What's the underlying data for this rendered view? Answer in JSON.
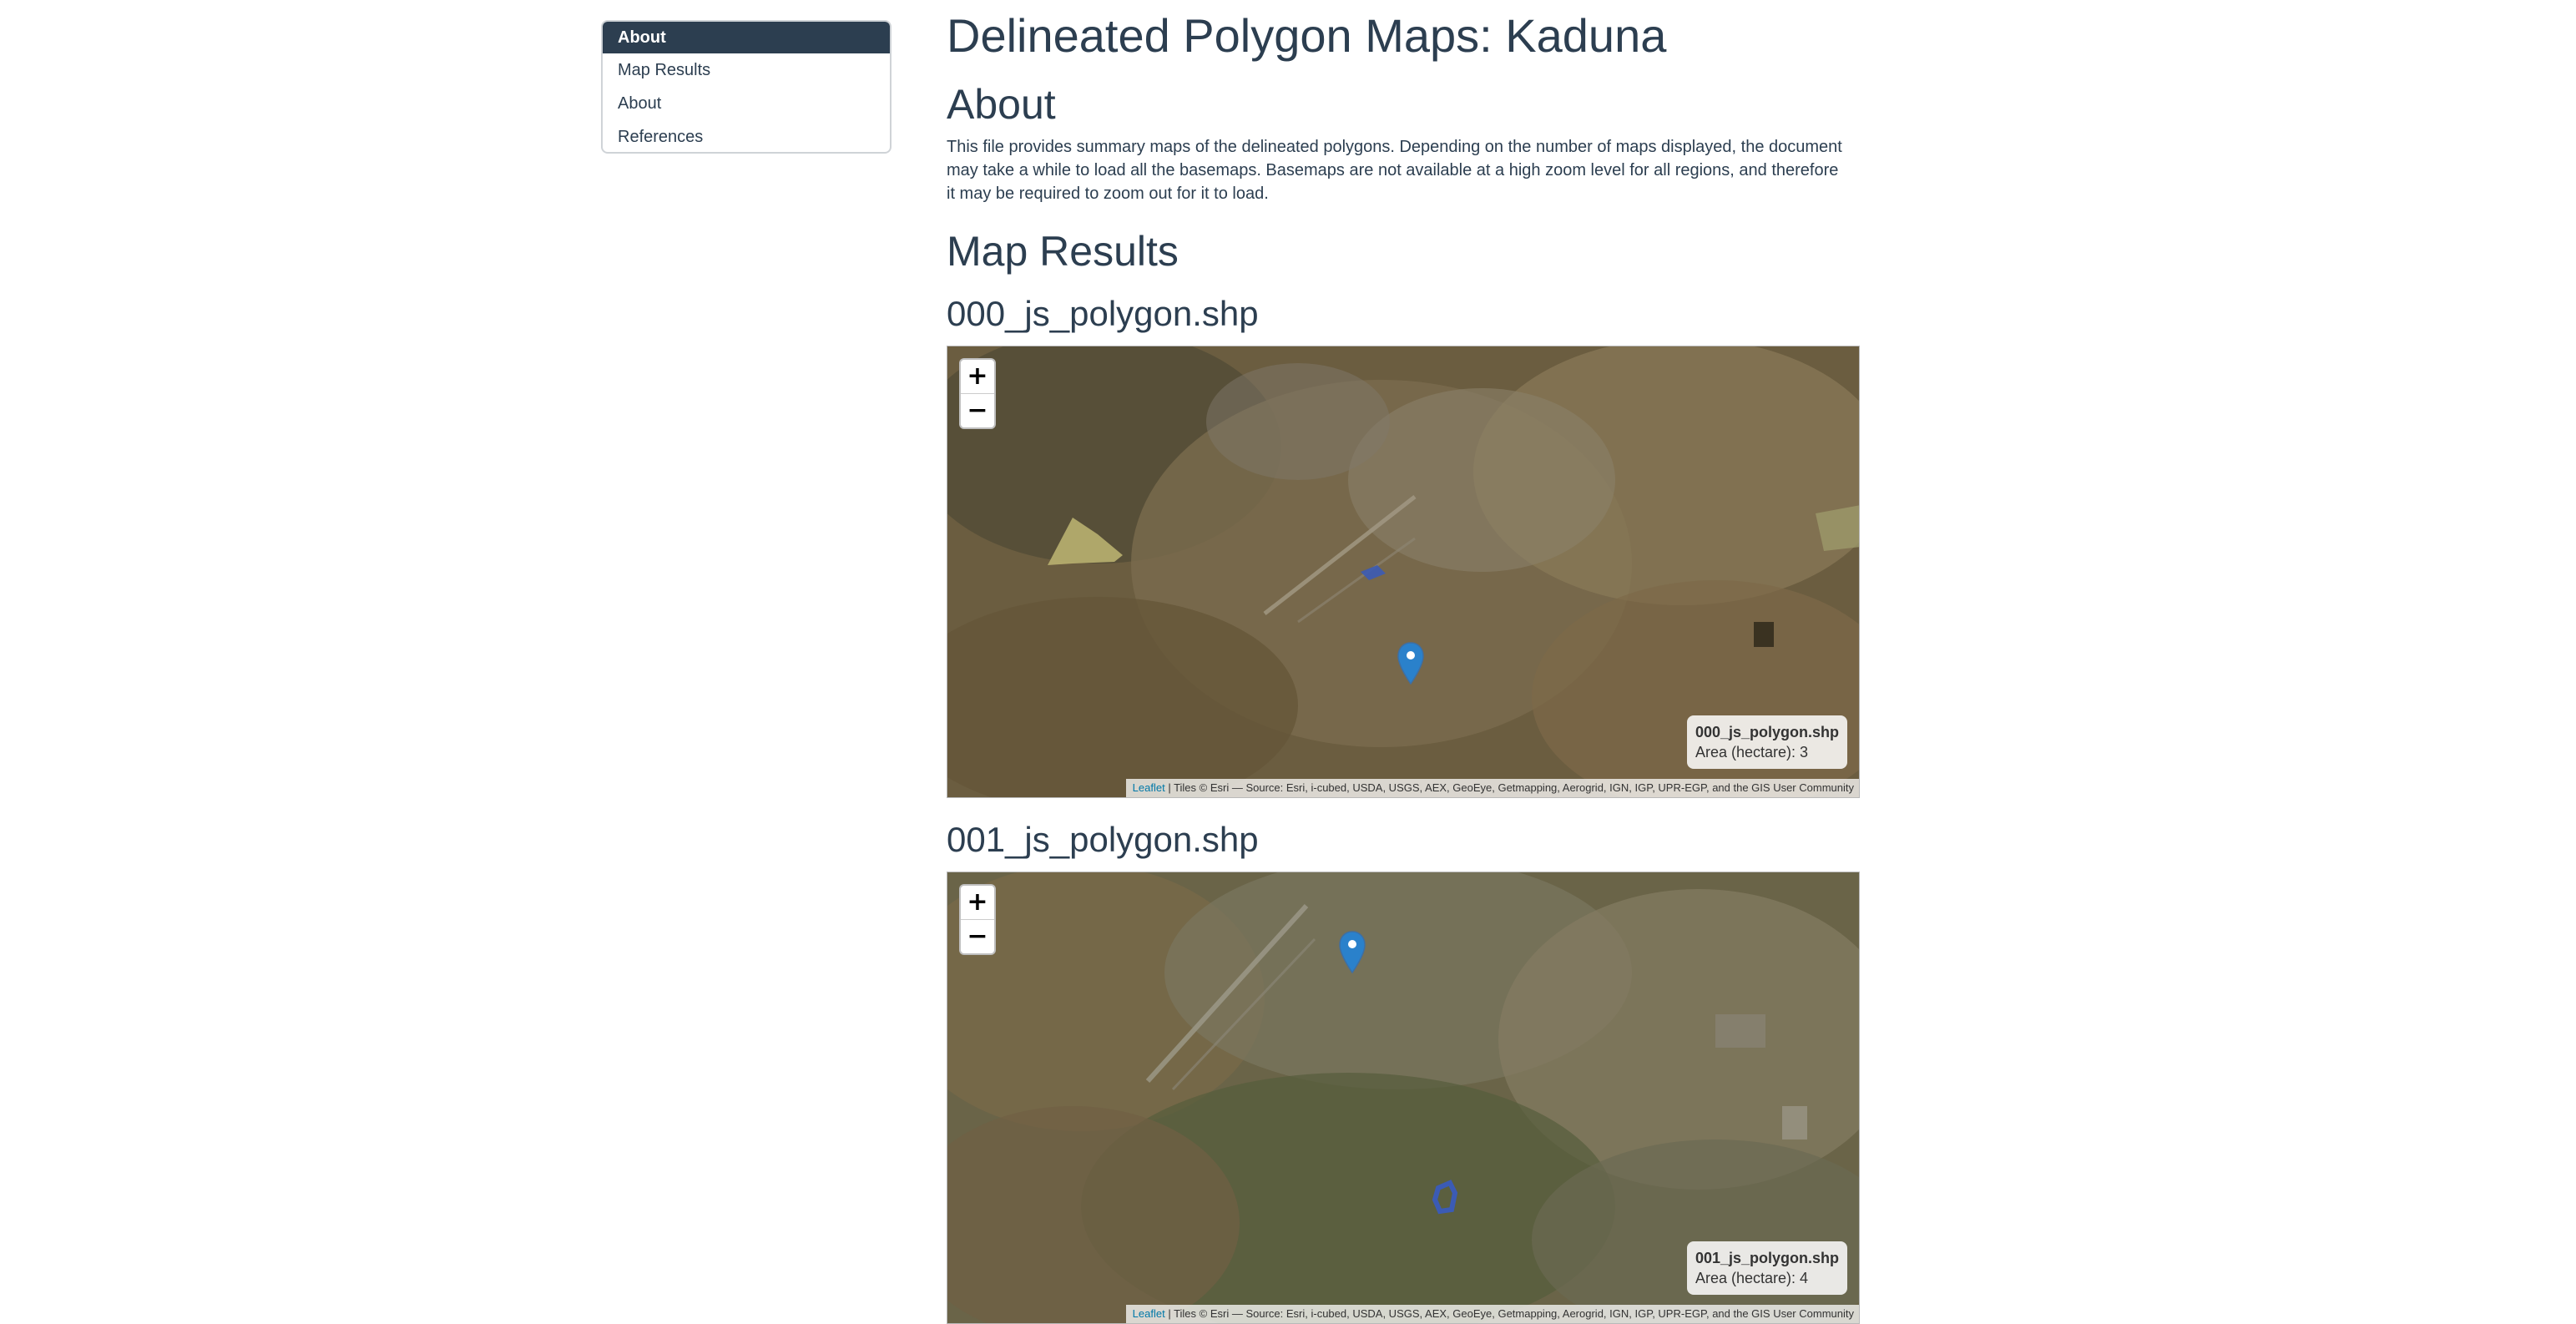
{
  "toc": {
    "items": [
      {
        "label": "About"
      },
      {
        "label": "Map Results"
      },
      {
        "label": "About"
      },
      {
        "label": "References"
      }
    ]
  },
  "page_title": "Delineated Polygon Maps: Kaduna",
  "about": {
    "heading": "About",
    "text": "This file provides summary maps of the delineated polygons. Depending on the number of maps displayed, the document may take a while to load all the basemaps. Basemaps are not available at a high zoom level for all regions, and therefore it may be required to zoom out for it to load."
  },
  "map_results": {
    "heading": "Map Results"
  },
  "maps": [
    {
      "title": "000_js_polygon.shp",
      "legend_title": "000_js_polygon.shp",
      "legend_text": "Area (hectare): 3",
      "zoom_in": "+",
      "zoom_out": "−",
      "attribution_link": "Leaflet",
      "attribution_text": " | Tiles © Esri — Source: Esri, i-cubed, USDA, USGS, AEX, GeoEye, Getmapping, Aerogrid, IGN, IGP, UPR-EGP, and the GIS User Community"
    },
    {
      "title": "001_js_polygon.shp",
      "legend_title": "001_js_polygon.shp",
      "legend_text": "Area (hectare): 4",
      "zoom_in": "+",
      "zoom_out": "−",
      "attribution_link": "Leaflet",
      "attribution_text": " | Tiles © Esri — Source: Esri, i-cubed, USDA, USGS, AEX, GeoEye, Getmapping, Aerogrid, IGN, IGP, UPR-EGP, and the GIS User Community"
    }
  ],
  "colors": {
    "heading": "#2c3e50",
    "toc_active_bg": "#2c3e50",
    "marker": "#2a81cb",
    "polygon": "#3b5bb5"
  },
  "icons": [
    "map-marker-icon",
    "zoom-in-icon",
    "zoom-out-icon"
  ]
}
